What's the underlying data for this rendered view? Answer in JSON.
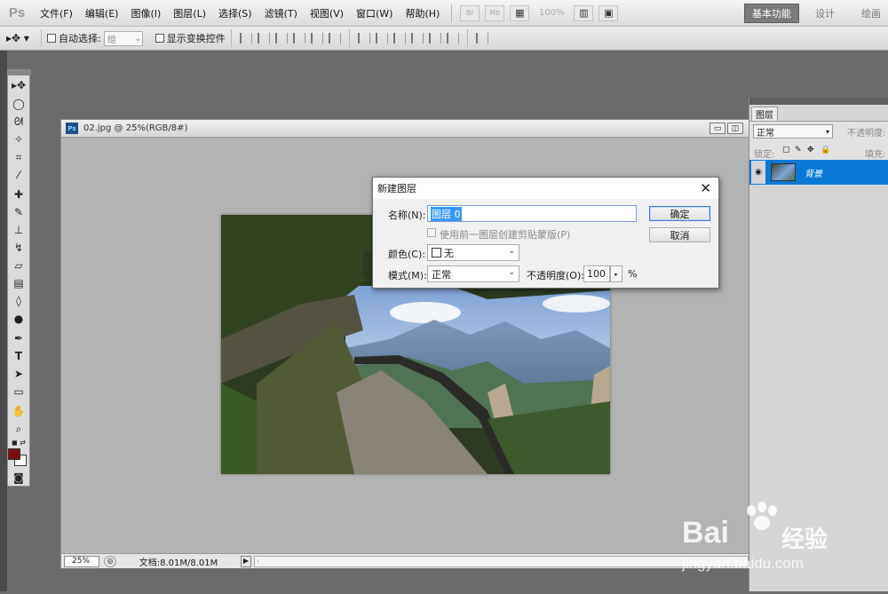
{
  "app": {
    "logo": "Ps"
  },
  "menu": [
    "文件(F)",
    "编辑(E)",
    "图像(I)",
    "图层(L)",
    "选择(S)",
    "滤镜(T)",
    "视图(V)",
    "窗口(W)",
    "帮助(H)"
  ],
  "menubar_tools": {
    "br": "Br",
    "mb": "Mb",
    "zoom": "100%"
  },
  "workspaces": {
    "active": "基本功能",
    "design": "设计",
    "paint": "绘画"
  },
  "options": {
    "auto_select": "自动选择:",
    "auto_select_value": "组",
    "show_transform": "显示变换控件"
  },
  "document": {
    "title": "02.jpg @ 25%(RGB/8#)",
    "zoom": "25%",
    "doc_size": "文档:8.01M/8.01M"
  },
  "layers_panel": {
    "tab": "图层",
    "blend_mode": "正常",
    "opacity_label": "不透明度:",
    "lock_label": "锁定:",
    "fill_label": "填充:",
    "layer_name": "背景"
  },
  "dialog": {
    "title": "新建图层",
    "name_label": "名称(N):",
    "name_value": "图层 0",
    "clip_label": "使用前一图层创建剪贴蒙版(P)",
    "color_label": "颜色(C):",
    "color_value": "无",
    "mode_label": "模式(M):",
    "mode_value": "正常",
    "opacity_label": "不透明度(O):",
    "opacity_value": "100",
    "opacity_unit": "%",
    "ok": "确定",
    "cancel": "取消"
  },
  "colors": {
    "foreground": "#7a0d0d",
    "background": "#ffffff",
    "layer_selected": "#0a79d6"
  },
  "watermark": {
    "brand": "Bai",
    "brand2": "经验",
    "url": "jingyan.baidu.com"
  }
}
